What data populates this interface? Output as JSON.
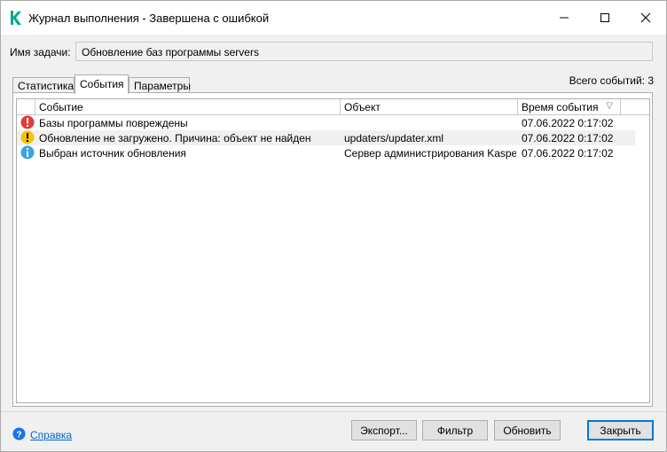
{
  "window": {
    "title": "Журнал выполнения - Завершена с ошибкой"
  },
  "task": {
    "label": "Имя задачи:",
    "value": "Обновление баз программы servers"
  },
  "tabs": [
    {
      "label": "Статистика",
      "active": false
    },
    {
      "label": "События",
      "active": true
    },
    {
      "label": "Параметры",
      "active": false
    }
  ],
  "total_events": "Всего событий: 3",
  "table": {
    "columns": [
      "Событие",
      "Объект",
      "Время события"
    ],
    "rows": [
      {
        "icon": "error-icon",
        "event": "Базы программы повреждены",
        "object": "",
        "time": "07.06.2022 0:17:02"
      },
      {
        "icon": "warning-icon",
        "event": "Обновление не загружено. Причина: объект не найден",
        "object": "updaters/updater.xml",
        "time": "07.06.2022 0:17:02"
      },
      {
        "icon": "info-icon",
        "event": "Выбран источник обновления",
        "object": "Сервер администрирования Kaspe...",
        "time": "07.06.2022 0:17:02"
      }
    ]
  },
  "footer": {
    "help": "Справка",
    "export": "Экспорт...",
    "filter": "Фильтр",
    "refresh": "Обновить",
    "close": "Закрыть"
  },
  "colors": {
    "brand": "#00a88e",
    "error": "#e03c3c",
    "warning": "#f5c400",
    "info": "#3aa3e3",
    "link": "#0066cc"
  }
}
